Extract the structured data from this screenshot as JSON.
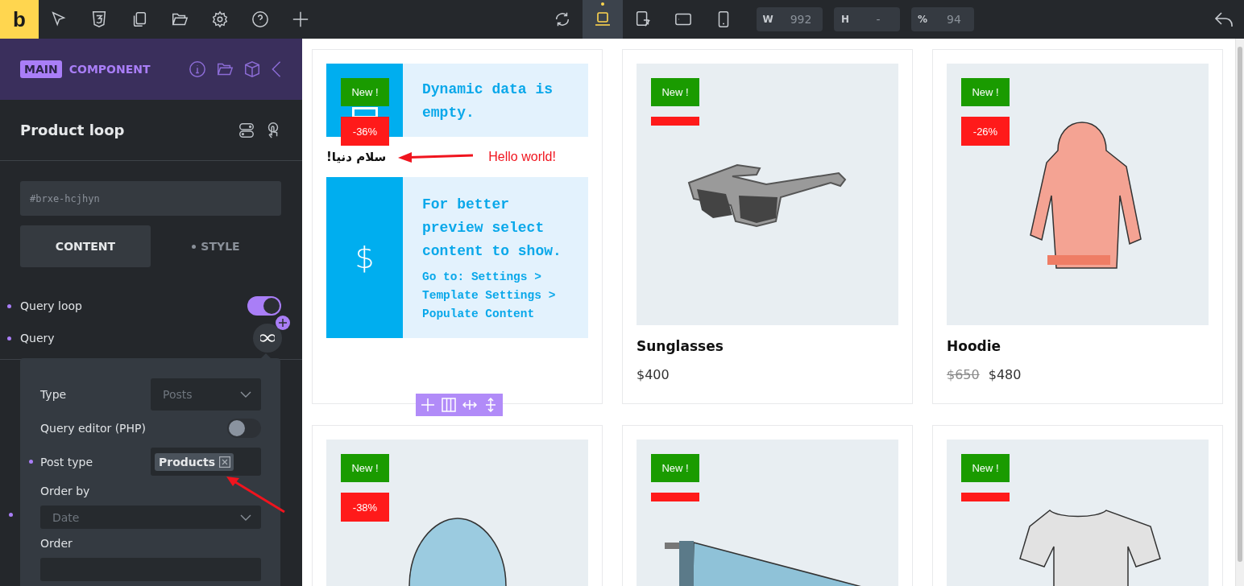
{
  "toolbar": {
    "logo": "b",
    "devices": [
      {
        "kind": "laptop",
        "selected": true
      },
      {
        "kind": "tablet-rotate",
        "selected": false
      },
      {
        "kind": "tablet-landscape",
        "selected": false
      },
      {
        "kind": "phone",
        "selected": false
      }
    ],
    "fields": [
      {
        "label": "W",
        "value": "992"
      },
      {
        "label": "H",
        "value": "-"
      },
      {
        "label": "%",
        "value": "94"
      }
    ]
  },
  "panel": {
    "header": {
      "badge": "MAIN",
      "label": "COMPONENT"
    },
    "element_title": "Product loop",
    "css_id": {
      "placeholder": "#brxe-hcjhyn"
    },
    "tabs": [
      {
        "label": "CONTENT",
        "selected": true,
        "modified": false
      },
      {
        "label": "STYLE",
        "selected": false,
        "modified": true
      }
    ],
    "controls": [
      {
        "kind": "toggle",
        "label": "Query loop",
        "modified": true,
        "on": true
      },
      {
        "kind": "query",
        "label": "Query",
        "modified": true
      }
    ],
    "covered_rows": [
      {
        "modified": true
      }
    ],
    "query_popup": {
      "fields": [
        {
          "kind": "select",
          "label": "Type",
          "placeholder": "Posts",
          "modified": false
        },
        {
          "kind": "toggle",
          "label": "Query editor (PHP)",
          "on": false,
          "modified": false
        },
        {
          "kind": "tags",
          "label": "Post type",
          "tags": [
            "Products"
          ],
          "modified": true
        },
        {
          "kind": "select-block",
          "label": "Order by",
          "placeholder": "Date",
          "modified": false
        },
        {
          "kind": "select-block",
          "label": "Order",
          "modified": false
        }
      ]
    }
  },
  "canvas": {
    "placeholder_card": {
      "new_badge": "New !",
      "discount": "-36%",
      "message": "Dynamic data is empty.",
      "greeting": "سلام دنیا!",
      "annotation": "Hello world!",
      "icon": "$",
      "preview_message": "For better preview select content to show.",
      "hint": "Go to: Settings > Template Settings > Populate Content"
    },
    "products": [
      {
        "kind": "sunglasses",
        "new_badge": "New !",
        "sale_badge": true,
        "name": "Sunglasses",
        "price": "$400"
      },
      {
        "kind": "hoodie",
        "new_badge": "New !",
        "sale_badge": true,
        "discount": "-26%",
        "name": "Hoodie",
        "regular_price": "$650",
        "price": "$480"
      },
      {
        "kind": "beanie",
        "new_badge": "New !",
        "sale_badge": true,
        "discount": "-38%"
      },
      {
        "kind": "pennant",
        "new_badge": "New !",
        "sale_badge": true
      },
      {
        "kind": "tshirt",
        "new_badge": "New !",
        "sale_badge": true
      }
    ]
  }
}
